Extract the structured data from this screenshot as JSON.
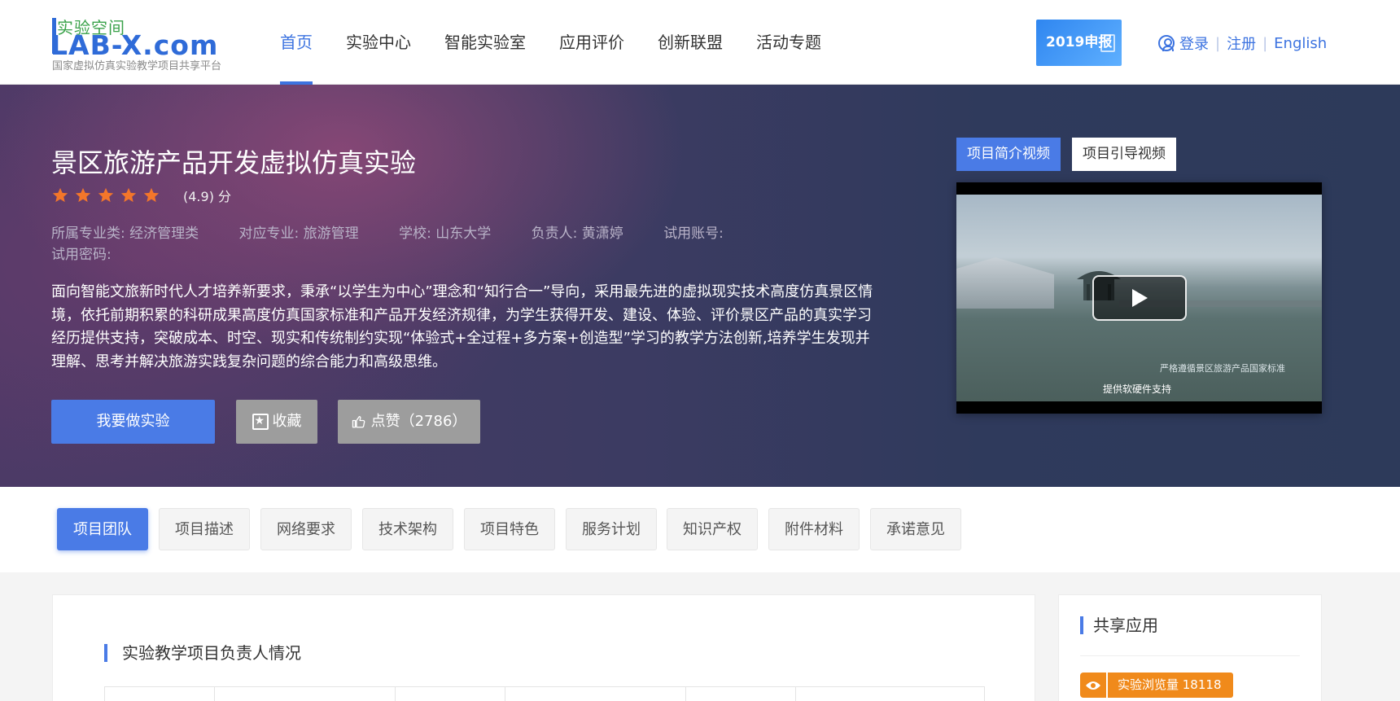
{
  "header": {
    "logo_top": "实验空间",
    "logo_main": "LAB-X.com",
    "logo_sub": "国家虚拟仿真实验教学项目共享平台",
    "nav": [
      "首页",
      "实验中心",
      "智能实验室",
      "应用评价",
      "创新联盟",
      "活动专题"
    ],
    "badge": "2019申报",
    "login": "登录",
    "register": "注册",
    "english": "English",
    "accent": "#3c73e0"
  },
  "hero": {
    "title": "景区旅游产品开发虚拟仿真实验",
    "stars": 5,
    "rating": "(4.9) 分",
    "meta": {
      "major_class": "所属专业类: 经济管理类",
      "major": "对应专业: 旅游管理",
      "school": "学校: 山东大学",
      "leader": "负责人: 黄潇婷",
      "trial_account": "试用账号:",
      "trial_password": "试用密码:"
    },
    "description": "面向智能文旅新时代人才培养新要求，秉承“以学生为中心”理念和“知行合一”导向，采用最先进的虚拟现实技术高度仿真景区情境，依托前期积累的科研成果高度仿真国家标准和产品开发经济规律，为学生获得开发、建设、体验、评价景区产品的真实学习经历提供支持，突破成本、时空、现实和传统制约实现“体验式+全过程+多方案+创造型”学习的教学方法创新,培养学生发现并理解、思考并解决旅游实践复杂问题的综合能力和高级思维。",
    "btn_do": "我要做实验",
    "btn_fav": "收藏",
    "btn_like": "点赞（2786）",
    "video_tabs": [
      "项目简介视频",
      "项目引导视频"
    ],
    "video_caption1": "严格遵循景区旅游产品国家标准",
    "video_caption2": "提供软硬件支持"
  },
  "tabs": [
    "项目团队",
    "项目描述",
    "网络要求",
    "技术架构",
    "项目特色",
    "服务计划",
    "知识产权",
    "附件材料",
    "承诺意见"
  ],
  "content": {
    "section_title": "实验教学项目负责人情况"
  },
  "sidebar": {
    "title": "共享应用",
    "views": "实验浏览量 18118"
  }
}
